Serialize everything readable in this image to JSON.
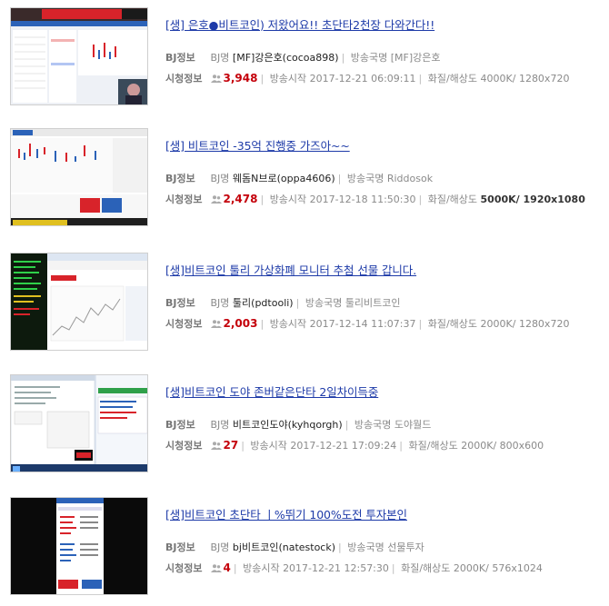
{
  "labels": {
    "bj_info": "BJ정보",
    "watch_info": "시청정보",
    "bj_name": "BJ명",
    "channel_name": "방송국명",
    "start_time": "방송시작",
    "quality": "화질/해상도"
  },
  "icons": {
    "viewers": "viewers-icon"
  },
  "colors": {
    "title_link": "#1d3aa8",
    "viewer_count": "#c4000a"
  },
  "streams": [
    {
      "title": "[생] 은호●비트코인) 저왔어요!! 초단타2천장 다와간다!!",
      "bj": "[MF]강은호(cocoa898)",
      "channel": "[MF]강은호",
      "viewers": "3,948",
      "start": "2017-12-21 06:09:11",
      "quality": "4000K/ 1280x720",
      "thumb_text": "비트코인 2천장 가즈아"
    },
    {
      "title": "[생] 비트코인 -35억 진행중 가즈아~~",
      "bj": "웨돔N브로(oppa4606)",
      "channel": "Riddosok",
      "viewers": "2,478",
      "start": "2017-12-18 11:50:30",
      "quality": "5000K/ 1920x1080",
      "thumb_text": ""
    },
    {
      "title": "[생]비트코인 툴리 가상화폐 모니터 추첨 선물 갑니다.",
      "bj": "툴리(pdtooli)",
      "channel": "툴리비트코인",
      "viewers": "2,003",
      "start": "2017-12-14 11:07:37",
      "quality": "2000K/ 1280x720",
      "thumb_text": ""
    },
    {
      "title": "[생]비트코인 도야 존버같은단타 2일차이득중",
      "bj": "비트코인도야(kyhqorgh)",
      "channel": "도야월드",
      "viewers": "27",
      "start": "2017-12-21 17:09:24",
      "quality": "2000K/ 800x600",
      "thumb_text": ""
    },
    {
      "title": "[생]비트코인 초단타 ㅣ%뛰기 100%도전 투자본인",
      "bj": "bj비트코인(natestock)",
      "channel": "선물투자",
      "viewers": "4",
      "start": "2017-12-21 12:57:30",
      "quality": "2000K/ 576x1024",
      "thumb_text": ""
    }
  ]
}
